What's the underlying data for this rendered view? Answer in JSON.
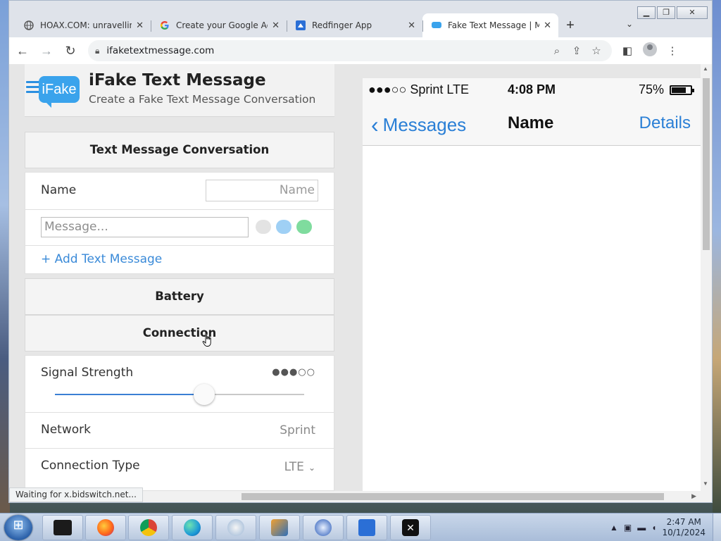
{
  "browser": {
    "tabs": [
      {
        "title": "HOAX.COM: unravelling",
        "icon": "globe-icon",
        "active": false
      },
      {
        "title": "Create your Google Acc",
        "icon": "google-icon",
        "active": false
      },
      {
        "title": "Redfinger App",
        "icon": "redfinger-icon",
        "active": false
      },
      {
        "title": "Fake Text Message | Ma",
        "icon": "message-bubble-icon",
        "active": true
      }
    ],
    "tab_close": "✕",
    "new_tab": "+",
    "url": "ifaketextmessage.com",
    "status_text": "Waiting for x.bidswitch.net..."
  },
  "site": {
    "logo_text": "iFake",
    "title": "iFake Text Message",
    "subtitle": "Create a Fake Text Message Conversation"
  },
  "form": {
    "conversation_header": "Text Message Conversation",
    "name_label": "Name",
    "name_placeholder": "Name",
    "message_placeholder": "Message...",
    "add_message": "+ Add Text Message",
    "battery_header": "Battery",
    "connection_header": "Connection",
    "signal_label": "Signal Strength",
    "signal_dots": "●●●○○",
    "signal_value": 0.6,
    "network_label": "Network",
    "network_value": "Sprint",
    "connection_type_label": "Connection Type",
    "connection_type_value": "LTE",
    "bubble_colors": [
      "#e3e3e3",
      "#9fd0f5",
      "#7fdc9e"
    ]
  },
  "phone": {
    "carrier": "●●●○○ Sprint  LTE",
    "time": "4:08 PM",
    "battery_pct": "75%",
    "battery_level": 0.75,
    "back_label": "Messages",
    "contact_name": "Name",
    "details_label": "Details"
  },
  "taskbar": {
    "clock_time": "2:47 AM",
    "clock_date": "10/1/2024"
  },
  "colors": {
    "accent_blue": "#2a7fd6",
    "link_blue": "#3a8ad8"
  }
}
